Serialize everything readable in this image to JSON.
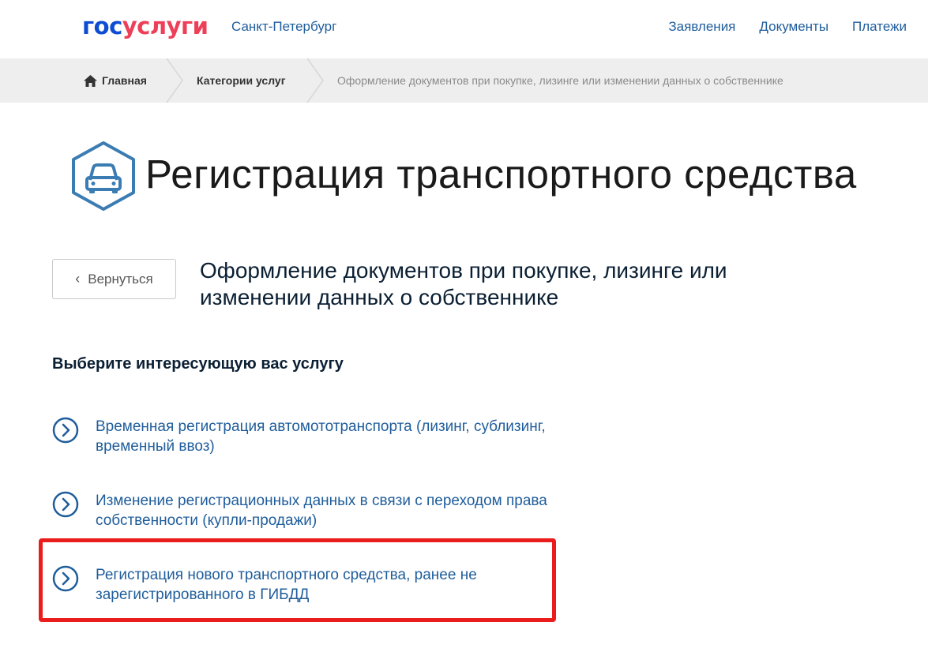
{
  "header": {
    "logo_part1": "гос",
    "logo_part2": "услуги",
    "city": "Санкт-Петербург",
    "nav": [
      "Заявления",
      "Документы",
      "Платежи"
    ]
  },
  "breadcrumb": {
    "home": "Главная",
    "category": "Категории услуг",
    "current": "Оформление документов при покупке, лизинге или изменении данных о собственнике",
    "home_icon": "home-icon"
  },
  "page": {
    "title": "Регистрация транспортного средства",
    "title_icon": "car-icon",
    "back_label": "Вернуться",
    "subtitle": "Оформление документов при покупке, лизинге или изменении данных о собственнике",
    "choose_label": "Выберите интересующую вас услугу"
  },
  "services": [
    {
      "label": "Временная регистрация автомототранспорта (лизинг, сублизинг, временный ввоз)",
      "icon": "chevron-right-circle-icon"
    },
    {
      "label": "Изменение регистрационных данных в связи с переходом права собственности (купли-продажи)",
      "icon": "chevron-right-circle-icon"
    },
    {
      "label": "Регистрация нового транспортного средства, ранее не зарегистрированного в ГИБДД",
      "icon": "chevron-right-circle-icon"
    }
  ],
  "colors": {
    "brand_blue": "#0d4cd3",
    "brand_red": "#ee3f58",
    "link": "#1f5d9b",
    "highlight": "#ea1c1c"
  }
}
